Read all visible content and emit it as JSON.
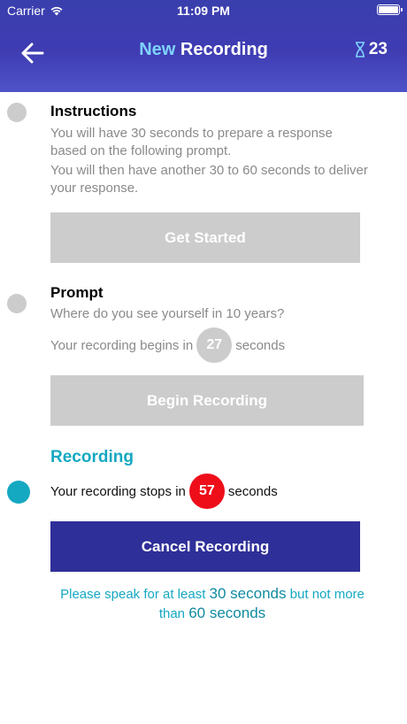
{
  "status_bar": {
    "carrier": "Carrier",
    "time": "11:09 PM"
  },
  "nav": {
    "title_accent": "New",
    "title_rest": "Recording",
    "timer_value": "23"
  },
  "instructions": {
    "heading": "Instructions",
    "line1": "You will have 30 seconds to prepare a response based on the following prompt.",
    "line2": "You will then have another 30 to 60 seconds to deliver your response.",
    "button": "Get Started"
  },
  "prompt": {
    "heading": "Prompt",
    "question": "Where do you see yourself in 10 years?",
    "begins_prefix": "Your recording begins in",
    "begins_count": "27",
    "begins_suffix": "seconds",
    "button": "Begin Recording"
  },
  "recording": {
    "heading": "Recording",
    "stops_prefix": "Your recording stops in",
    "stops_count": "57",
    "stops_suffix": "seconds",
    "button": "Cancel Recording"
  },
  "note": {
    "part1": "Please speak for at least",
    "min": "30 seconds",
    "part2": "but not more than",
    "max": "60 seconds"
  },
  "colors": {
    "header": "#3f3cb2",
    "accent_light": "#7fd3ff",
    "teal": "#15a8c1",
    "disabled": "#cccccc",
    "primary_button": "#2f2f99",
    "red_badge": "#ee0e1a"
  }
}
